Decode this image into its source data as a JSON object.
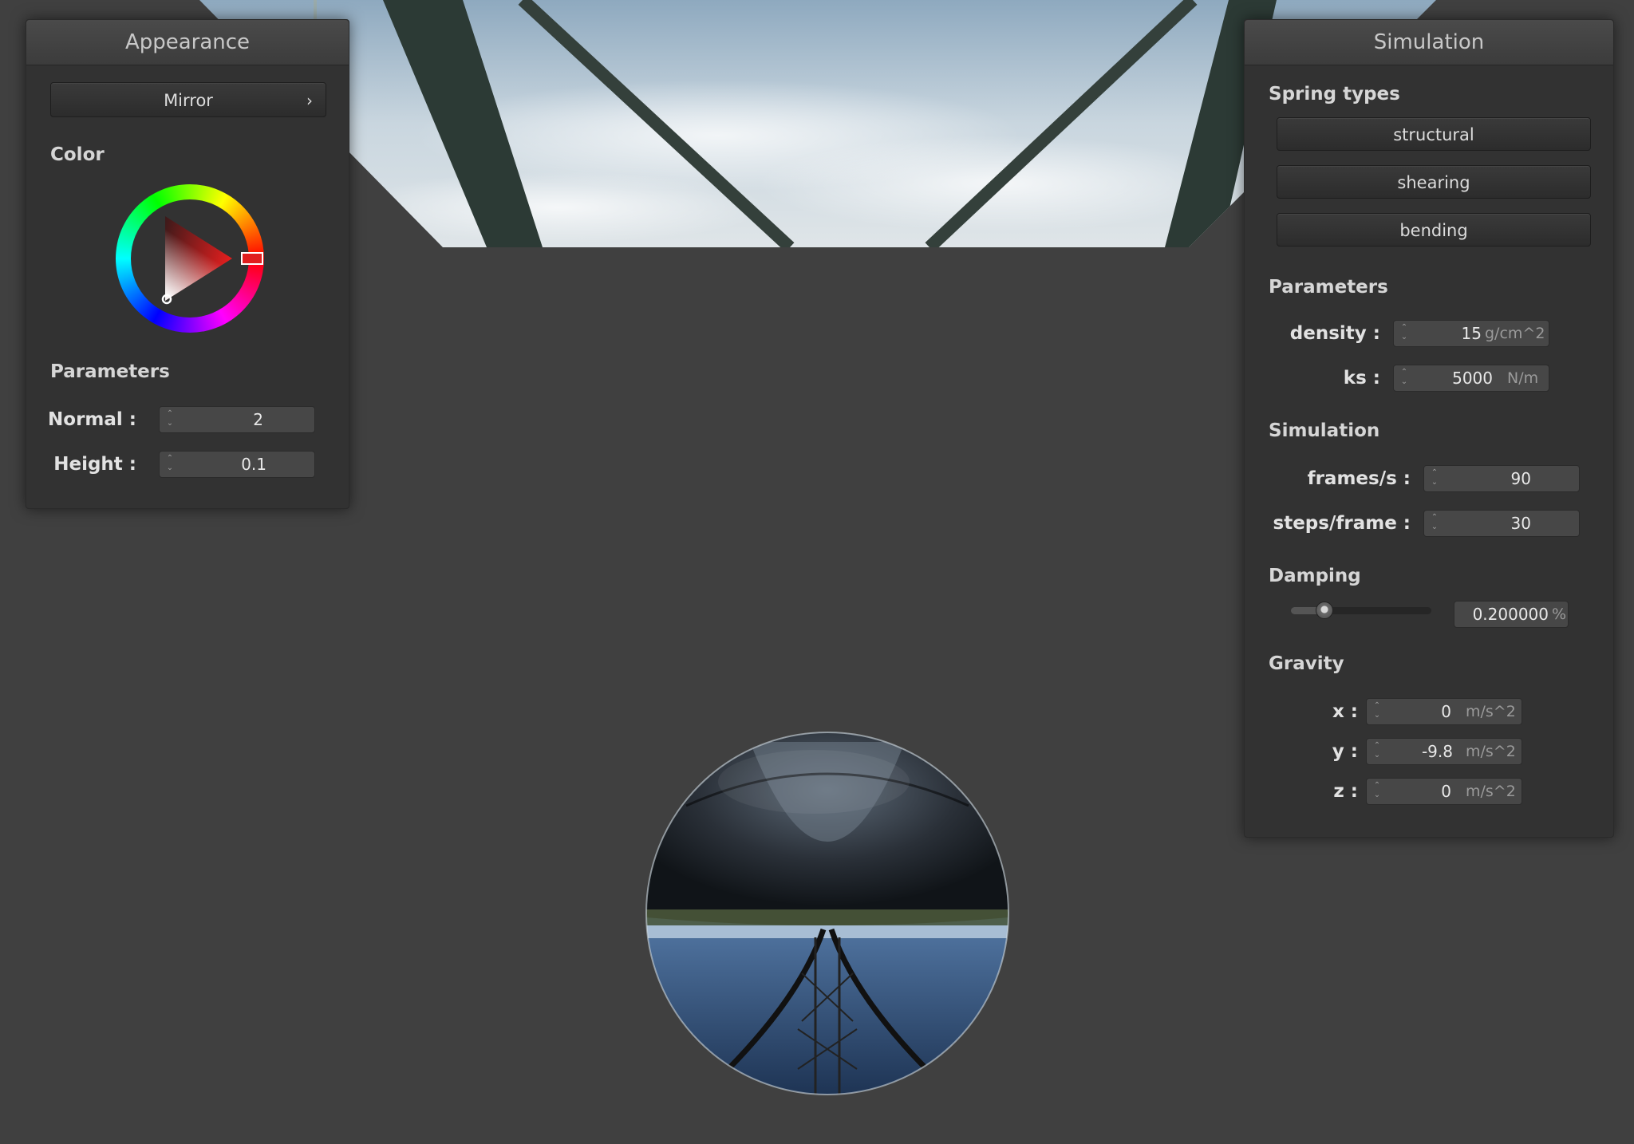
{
  "appearance": {
    "title": "Appearance",
    "shader_button": {
      "label": "Mirror",
      "chevron": "›"
    },
    "color_section": "Color",
    "color_wheel": {
      "selected_hue_color": "#e01e1e"
    },
    "params_section": "Parameters",
    "normal": {
      "label": "Normal :",
      "value": "2"
    },
    "height": {
      "label": "Height :",
      "value": "0.1"
    }
  },
  "simulation": {
    "title": "Simulation",
    "spring_section": "Spring types",
    "spring_buttons": [
      "structural",
      "shearing",
      "bending"
    ],
    "params_section": "Parameters",
    "density": {
      "label": "density :",
      "value": "15",
      "unit": "g/cm^2"
    },
    "ks": {
      "label": "ks :",
      "value": "5000",
      "unit": "N/m"
    },
    "sim_section": "Simulation",
    "fps": {
      "label": "frames/s :",
      "value": "90"
    },
    "steps": {
      "label": "steps/frame :",
      "value": "30"
    },
    "damping_section": "Damping",
    "damping": {
      "value": "0.200000",
      "unit": "%",
      "slider_fraction": 0.2
    },
    "gravity_section": "Gravity",
    "gravity": [
      {
        "label": "x :",
        "value": "0",
        "unit": "m/s^2"
      },
      {
        "label": "y :",
        "value": "-9.8",
        "unit": "m/s^2"
      },
      {
        "label": "z :",
        "value": "0",
        "unit": "m/s^2"
      }
    ]
  },
  "colors": {
    "background": "#404040",
    "panel": "#323232",
    "sky": "#b9cbd8"
  }
}
